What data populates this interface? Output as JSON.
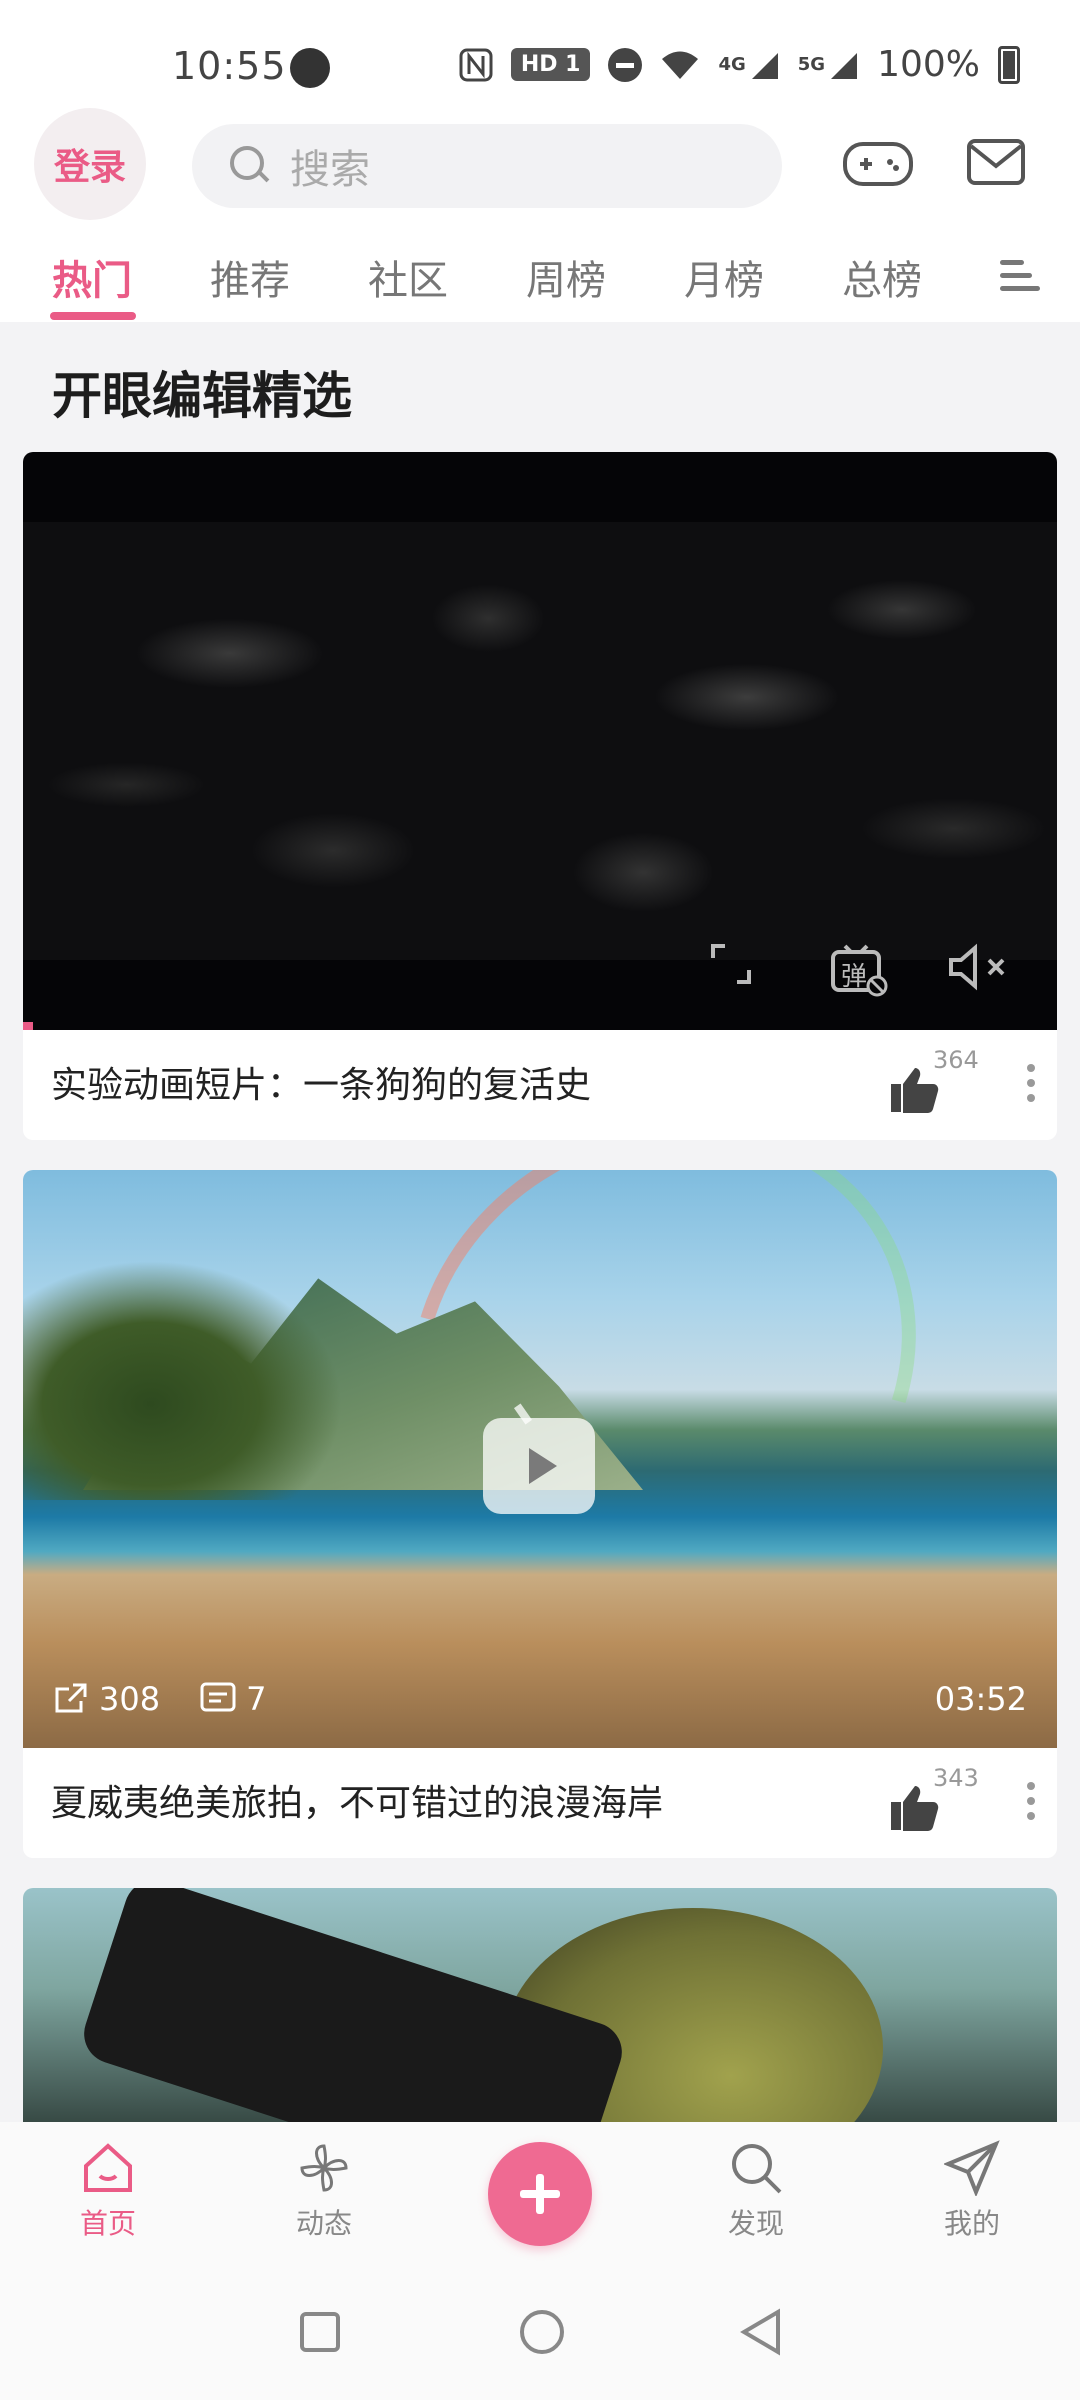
{
  "status_bar": {
    "time": "10:55",
    "hd_label": "HD 1",
    "net_4g": "4G",
    "net_5g": "5G",
    "battery": "100%"
  },
  "header": {
    "login_label": "登录",
    "search_placeholder": "搜索"
  },
  "tabs": [
    {
      "label": "热门",
      "active": true
    },
    {
      "label": "推荐"
    },
    {
      "label": "社区"
    },
    {
      "label": "周榜"
    },
    {
      "label": "月榜"
    },
    {
      "label": "总榜"
    }
  ],
  "section": {
    "title": "开眼编辑精选"
  },
  "cards": [
    {
      "title": "实验动画短片：一条狗狗的复活史",
      "likes": "364",
      "danmu_label": "弹"
    },
    {
      "title": "夏威夷绝美旅拍，不可错过的浪漫海岸",
      "likes": "343",
      "shares": "308",
      "comments": "7",
      "duration": "03:52"
    }
  ],
  "bottom_nav": [
    {
      "label": "首页",
      "icon": "home-icon",
      "active": true
    },
    {
      "label": "动态",
      "icon": "pinwheel-icon"
    },
    {
      "label": "发现",
      "icon": "search-icon"
    },
    {
      "label": "我的",
      "icon": "paper-plane-icon"
    }
  ],
  "colors": {
    "accent": "#ea5b86",
    "fab": "#ef6a92"
  }
}
